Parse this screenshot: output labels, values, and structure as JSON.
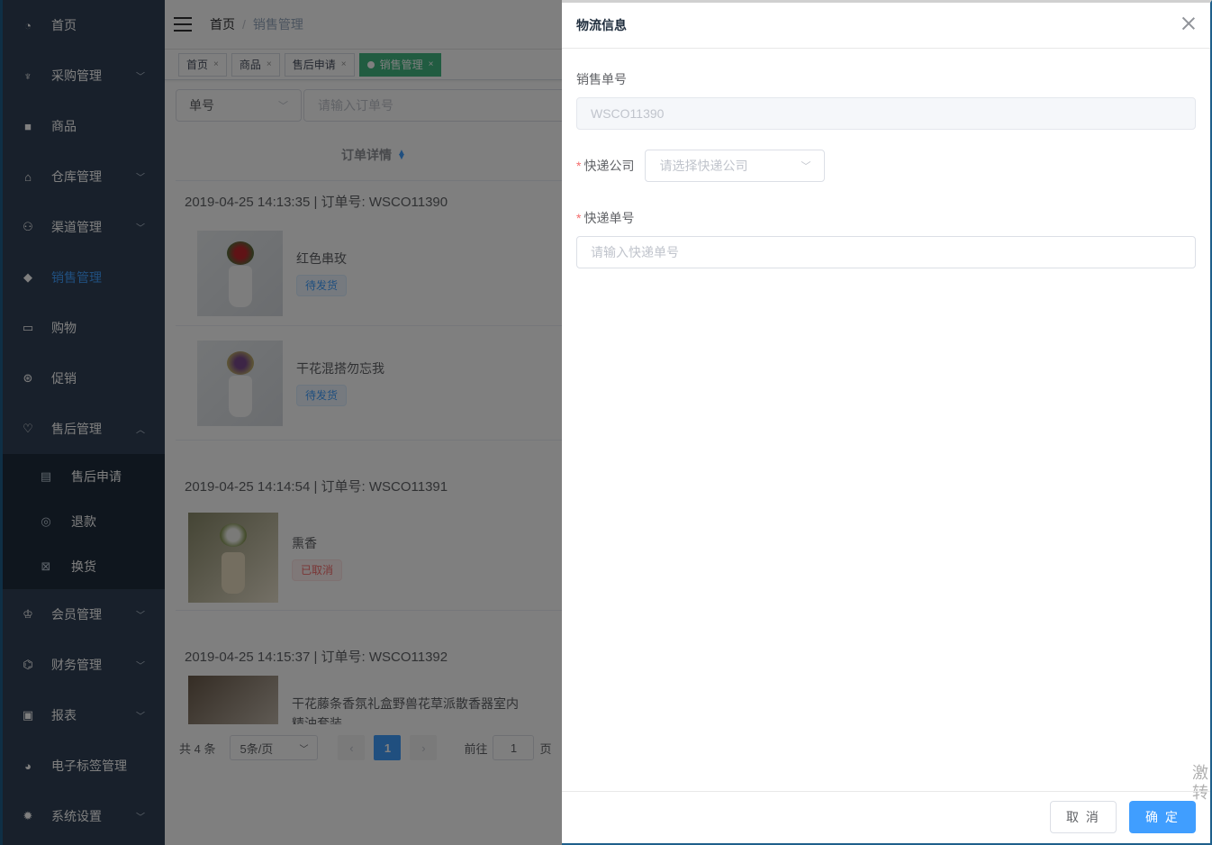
{
  "sidebar": {
    "items": [
      {
        "label": "首页",
        "icon": "dashboard-icon",
        "arrow": ""
      },
      {
        "label": "采购管理",
        "icon": "purchase-icon",
        "arrow": "﹀"
      },
      {
        "label": "商品",
        "icon": "bag-icon",
        "arrow": ""
      },
      {
        "label": "仓库管理",
        "icon": "warehouse-icon",
        "arrow": "﹀"
      },
      {
        "label": "渠道管理",
        "icon": "channel-icon",
        "arrow": "﹀"
      },
      {
        "label": "销售管理",
        "icon": "tag-icon",
        "arrow": ""
      },
      {
        "label": "购物",
        "icon": "basket-icon",
        "arrow": ""
      },
      {
        "label": "促销",
        "icon": "discount-icon",
        "arrow": ""
      },
      {
        "label": "售后管理",
        "icon": "heart-icon",
        "arrow": "︿"
      }
    ],
    "submenu": [
      {
        "label": "售后申请",
        "icon": "document-icon"
      },
      {
        "label": "退款",
        "icon": "refund-icon"
      },
      {
        "label": "换货",
        "icon": "exchange-icon"
      }
    ],
    "items2": [
      {
        "label": "会员管理",
        "icon": "crown-icon",
        "arrow": "﹀"
      },
      {
        "label": "财务管理",
        "icon": "finance-icon",
        "arrow": "﹀"
      },
      {
        "label": "报表",
        "icon": "report-icon",
        "arrow": "﹀"
      },
      {
        "label": "电子标签管理",
        "icon": "label-icon",
        "arrow": ""
      },
      {
        "label": "系统设置",
        "icon": "gear-icon",
        "arrow": "﹀"
      }
    ]
  },
  "navbar": {
    "crumb_home": "首页",
    "crumb_sep": "/",
    "crumb_current": "销售管理"
  },
  "tags": [
    "首页",
    "商品",
    "售后申请",
    "销售管理"
  ],
  "filter": {
    "select_value": "单号",
    "input_placeholder": "请输入订单号"
  },
  "table": {
    "header": "订单详情"
  },
  "orders": [
    {
      "header": "2019-04-25 14:13:35 | 订单号: WSCO11390",
      "products": [
        {
          "name": "红色串玫",
          "status": "待发货",
          "status_color": "blue"
        },
        {
          "name": "干花混搭勿忘我",
          "status": "待发货",
          "status_color": "blue"
        }
      ]
    },
    {
      "header": "2019-04-25 14:14:54 | 订单号: WSCO11391",
      "products": [
        {
          "name": "熏香",
          "status": "已取消",
          "status_color": "red"
        }
      ]
    },
    {
      "header": "2019-04-25 14:15:37 | 订单号: WSCO11392",
      "products": [
        {
          "name": "干花藤条香氛礼盒野兽花草派散香器室内精油套装",
          "status": "",
          "status_color": ""
        }
      ]
    }
  ],
  "pager": {
    "total": "共 4 条",
    "size": "5条/页",
    "current": "1",
    "goto_prefix": "前往",
    "goto_value": "1",
    "goto_suffix": "页"
  },
  "drawer": {
    "title": "物流信息",
    "order_label": "销售单号",
    "order_value": "WSCO11390",
    "company_label": "快递公司",
    "company_placeholder": "请选择快递公司",
    "tracking_label": "快递单号",
    "tracking_placeholder": "请输入快递单号",
    "cancel_label": "取 消",
    "ok_label": "确 定"
  },
  "side_watermark": [
    "激",
    "转"
  ],
  "colors": {
    "sidebar_bg": "#304156",
    "accent": "#409eff",
    "tag_active": "#42b983"
  }
}
